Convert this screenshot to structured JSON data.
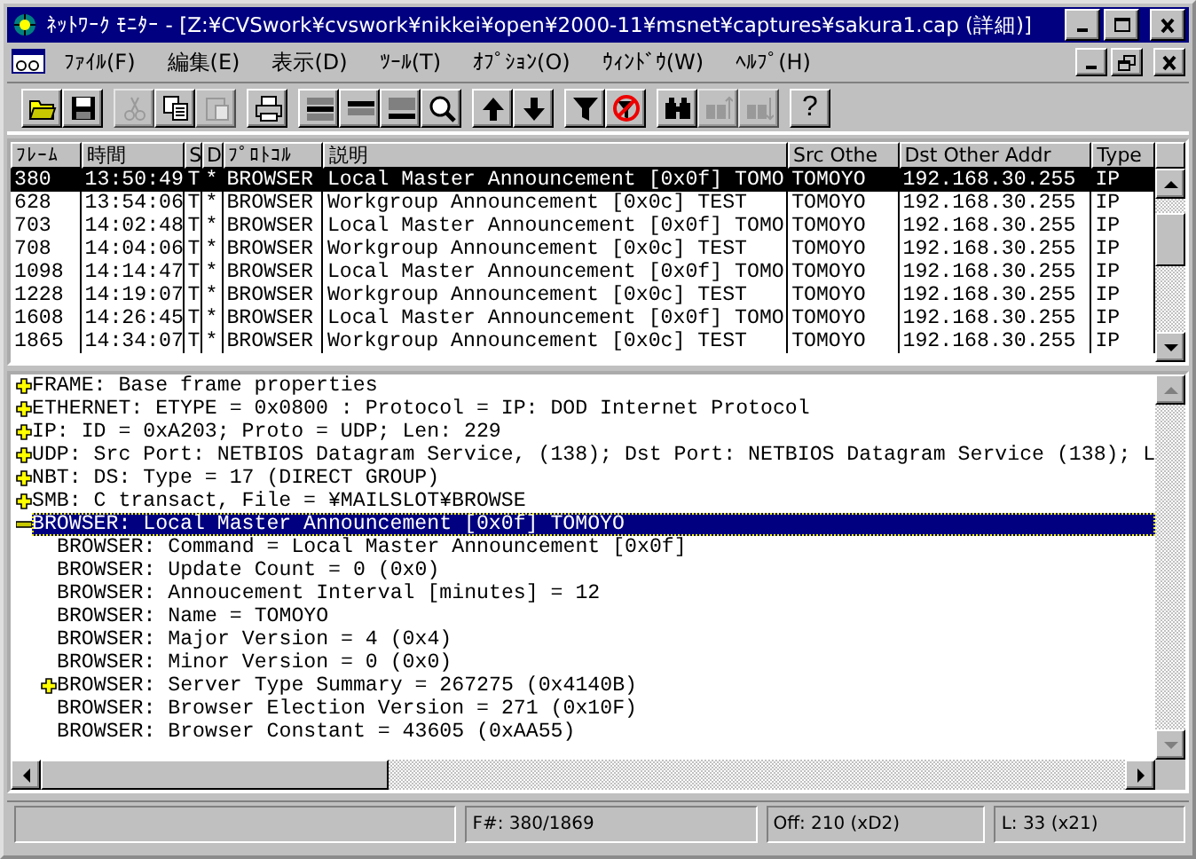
{
  "window": {
    "title": "ﾈｯﾄﾜｰｸ ﾓﾆﾀｰ - [Z:¥CVSwork¥cvswork¥nikkei¥open¥2000-11¥msnet¥captures¥sakura1.cap (詳細)]"
  },
  "menu": [
    "ﾌｧｲﾙ(F)",
    "編集(E)",
    "表示(D)",
    "ﾂｰﾙ(T)",
    "ｵﾌﾟｼｮﾝ(O)",
    "ｳｨﾝﾄﾞｳ(W)",
    "ﾍﾙﾌﾟ(H)"
  ],
  "toolbar": [
    [
      {
        "disabled": false
      },
      {
        "disabled": false
      }
    ],
    [
      {
        "disabled": true
      },
      {
        "disabled": false
      },
      {
        "disabled": true
      }
    ],
    [
      {
        "disabled": false
      }
    ],
    [
      {
        "disabled": false
      },
      {
        "disabled": false
      },
      {
        "disabled": false
      },
      {
        "disabled": false
      }
    ],
    [
      {
        "disabled": false
      },
      {
        "disabled": false
      }
    ],
    [
      {
        "disabled": false
      },
      {
        "disabled": false
      }
    ],
    [
      {
        "disabled": false
      },
      {
        "disabled": true
      },
      {
        "disabled": true
      }
    ],
    [
      {
        "disabled": false,
        "label": "?"
      }
    ]
  ],
  "packets": {
    "columns": [
      "ﾌﾚｰﾑ",
      "時間",
      "S",
      "D",
      "ﾌﾟﾛﾄｺﾙ",
      "説明",
      "Src Othe",
      "Dst Other Addr",
      "Type"
    ],
    "rows": [
      {
        "selected": true,
        "cells": [
          "380",
          "13:50:49",
          "T",
          "*",
          "BROWSER",
          "Local Master Announcement [0x0f] TOMO",
          "TOMOYO",
          "192.168.30.255",
          "IP"
        ]
      },
      {
        "selected": false,
        "cells": [
          "628",
          "13:54:06",
          "T",
          "*",
          "BROWSER",
          "Workgroup Announcement [0x0c] TEST",
          "TOMOYO",
          "192.168.30.255",
          "IP"
        ]
      },
      {
        "selected": false,
        "cells": [
          "703",
          "14:02:48",
          "T",
          "*",
          "BROWSER",
          "Local Master Announcement [0x0f] TOMO",
          "TOMOYO",
          "192.168.30.255",
          "IP"
        ]
      },
      {
        "selected": false,
        "cells": [
          "708",
          "14:04:06",
          "T",
          "*",
          "BROWSER",
          "Workgroup Announcement [0x0c] TEST",
          "TOMOYO",
          "192.168.30.255",
          "IP"
        ]
      },
      {
        "selected": false,
        "cells": [
          "1098",
          "14:14:47",
          "T",
          "*",
          "BROWSER",
          "Local Master Announcement [0x0f] TOMO",
          "TOMOYO",
          "192.168.30.255",
          "IP"
        ]
      },
      {
        "selected": false,
        "cells": [
          "1228",
          "14:19:07",
          "T",
          "*",
          "BROWSER",
          "Workgroup Announcement [0x0c] TEST",
          "TOMOYO",
          "192.168.30.255",
          "IP"
        ]
      },
      {
        "selected": false,
        "cells": [
          "1608",
          "14:26:45",
          "T",
          "*",
          "BROWSER",
          "Local Master Announcement [0x0f] TOMO",
          "TOMOYO",
          "192.168.30.255",
          "IP"
        ]
      },
      {
        "selected": false,
        "cells": [
          "1865",
          "14:34:07",
          "T",
          "*",
          "BROWSER",
          "Workgroup Announcement [0x0c] TEST",
          "TOMOYO",
          "192.168.30.255",
          "IP"
        ]
      }
    ]
  },
  "detail": {
    "items": [
      {
        "text": "FRAME: Base frame properties",
        "expanded": false,
        "selected": false
      },
      {
        "text": "ETHERNET: ETYPE = 0x0800 : Protocol = IP:  DOD Internet Protocol",
        "expanded": false,
        "selected": false
      },
      {
        "text": "IP: ID = 0xA203; Proto = UDP; Len: 229",
        "expanded": false,
        "selected": false
      },
      {
        "text": "UDP: Src Port: NETBIOS Datagram Service, (138); Dst Port: NETBIOS Datagram Service (138); L",
        "expanded": false,
        "selected": false
      },
      {
        "text": "NBT: DS: Type = 17 (DIRECT GROUP)",
        "expanded": false,
        "selected": false
      },
      {
        "text": "SMB: C transact, File = ¥MAILSLOT¥BROWSE",
        "expanded": false,
        "selected": false
      },
      {
        "text": "BROWSER: Local Master Announcement [0x0f] TOMOYO",
        "expanded": true,
        "selected": true,
        "children": [
          {
            "text": "BROWSER: Command = Local Master Announcement [0x0f]",
            "selected": false
          },
          {
            "text": "BROWSER: Update Count = 0 (0x0)",
            "selected": false
          },
          {
            "text": "BROWSER: Annoucement Interval [minutes] = 12",
            "selected": false
          },
          {
            "text": "BROWSER: Name = TOMOYO",
            "selected": false
          },
          {
            "text": "BROWSER: Major Version = 4 (0x4)",
            "selected": false
          },
          {
            "text": "BROWSER: Minor Version = 0 (0x0)",
            "selected": false
          },
          {
            "text": "BROWSER: Server Type Summary = 267275 (0x4140B)",
            "expanded": false,
            "selected": false
          },
          {
            "text": "BROWSER: Browser Election Version = 271 (0x10F)",
            "selected": false
          },
          {
            "text": "BROWSER: Browser Constant = 43605 (0xAA55)",
            "selected": false
          }
        ]
      }
    ]
  },
  "status_bar": [
    "F#: 380/1869",
    "Off: 210 (xD2)",
    "L: 33 (x21)"
  ]
}
